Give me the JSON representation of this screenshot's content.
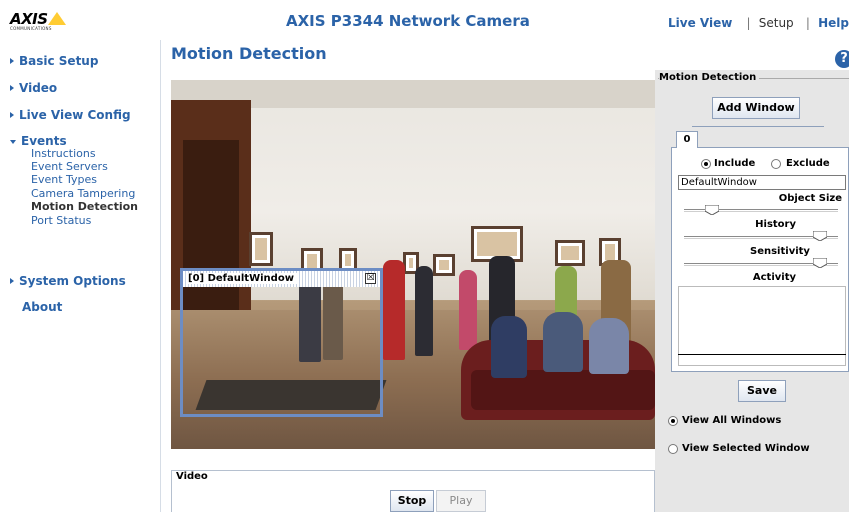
{
  "header": {
    "logo_text": "AXIS",
    "logo_sub": "COMMUNICATIONS",
    "title": "AXIS P3344 Network Camera",
    "nav": {
      "live_view": "Live View",
      "setup": "Setup",
      "help": "Help",
      "separator": "|"
    }
  },
  "sidebar": {
    "basic_setup": "Basic Setup",
    "video": "Video",
    "live_view_config": "Live View Config",
    "events": "Events",
    "events_items": [
      "Instructions",
      "Event Servers",
      "Event Types",
      "Camera Tampering",
      "Motion Detection",
      "Port Status"
    ],
    "system_options": "System Options",
    "about": "About"
  },
  "main": {
    "title": "Motion Detection",
    "motion_window_title": "[0] DefaultWindow",
    "motion_window_close": "☒",
    "video_section": {
      "label": "Video",
      "stop": "Stop",
      "play": "Play"
    }
  },
  "panel": {
    "legend": "Motion Detection",
    "add_window": "Add Window",
    "tab": "0",
    "include": "Include",
    "exclude": "Exclude",
    "window_name": "DefaultWindow",
    "object_size": "Object Size",
    "object_size_level": 0.15,
    "history": "History",
    "history_level": 0.92,
    "sensitivity": "Sensitivity",
    "sensitivity_level": 0.92,
    "activity": "Activity",
    "save": "Save",
    "view_all": "View All Windows",
    "view_selected": "View Selected Window",
    "help_icon_glyph": "?"
  },
  "colors": {
    "accent": "#2b63a8",
    "logo_yellow": "#ffcc33",
    "window_border": "#6d8dc4"
  }
}
